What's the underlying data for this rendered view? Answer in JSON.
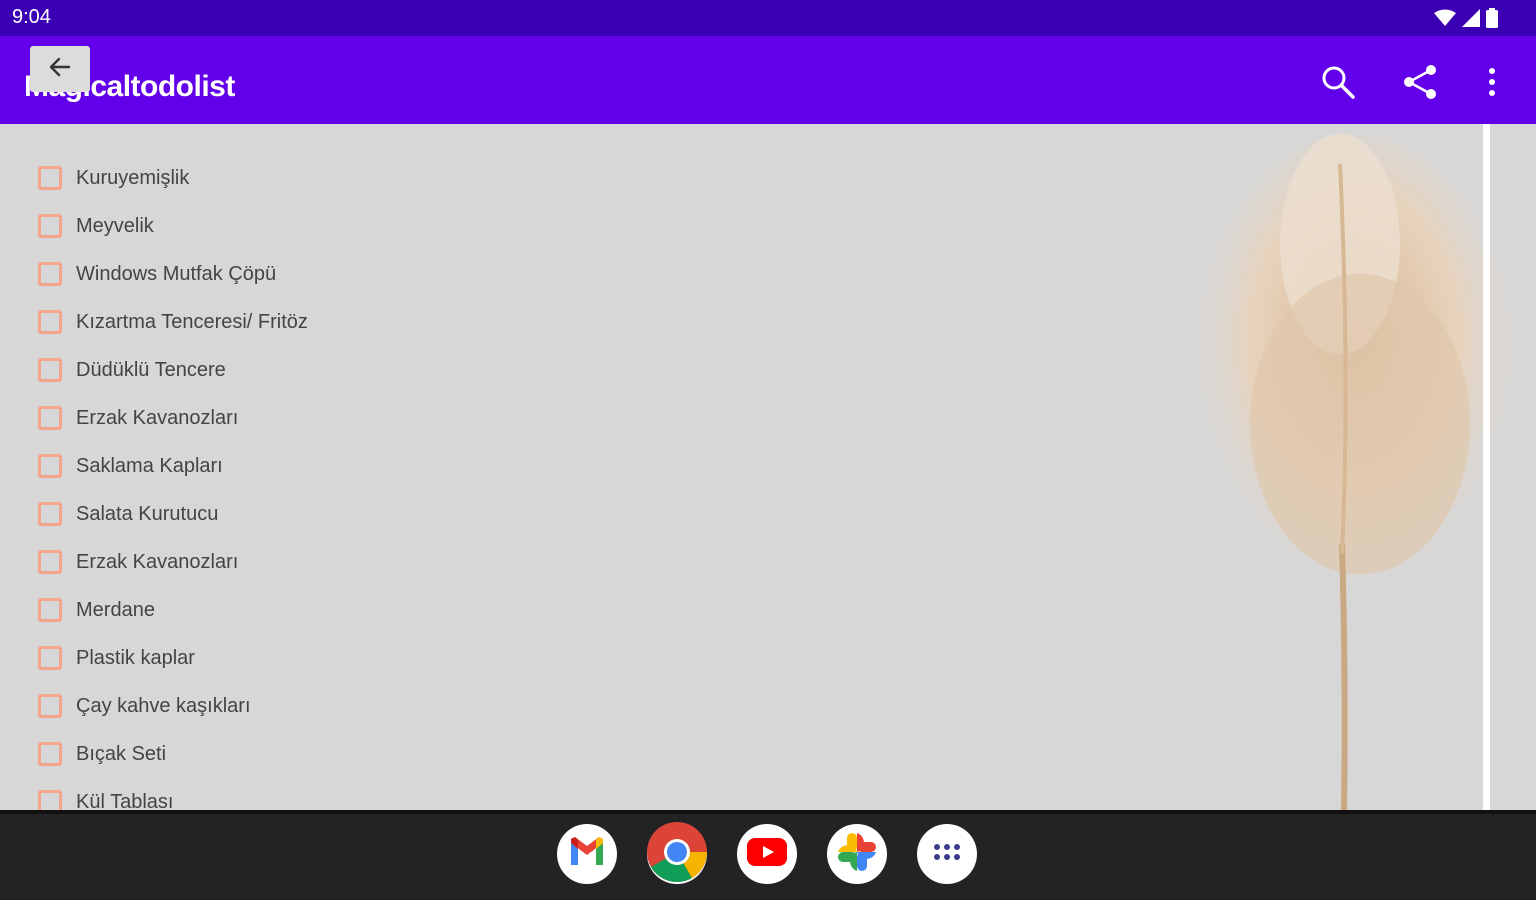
{
  "status": {
    "time": "9:04"
  },
  "app_bar": {
    "title": "Magicaltodolist"
  },
  "list": {
    "items": [
      {
        "label": "Kuruyemişlik",
        "checked": false
      },
      {
        "label": "Meyvelik",
        "checked": false
      },
      {
        "label": "Windows Mutfak Çöpü",
        "checked": false
      },
      {
        "label": "Kızartma Tenceresi/ Fritöz",
        "checked": false
      },
      {
        "label": "Düdüklü Tencere",
        "checked": false
      },
      {
        "label": "Erzak Kavanozları",
        "checked": false
      },
      {
        "label": "Saklama Kapları",
        "checked": false
      },
      {
        "label": "Salata Kurutucu",
        "checked": false
      },
      {
        "label": "Erzak Kavanozları",
        "checked": false
      },
      {
        "label": "Merdane",
        "checked": false
      },
      {
        "label": "Plastik kaplar",
        "checked": false
      },
      {
        "label": "Çay kahve kaşıkları",
        "checked": false
      },
      {
        "label": "Bıçak Seti",
        "checked": false
      },
      {
        "label": "Kül Tablası",
        "checked": false
      }
    ]
  },
  "dock": {
    "apps": [
      {
        "icon": "gmail-icon"
      },
      {
        "icon": "chrome-icon"
      },
      {
        "icon": "youtube-icon"
      },
      {
        "icon": "photos-icon"
      },
      {
        "icon": "app-drawer-icon"
      }
    ]
  },
  "colors": {
    "status_bar": "#3c00b4",
    "app_bar": "#6200ea",
    "checkbox_border": "#f4a48a",
    "background": "#d7d7d7"
  }
}
